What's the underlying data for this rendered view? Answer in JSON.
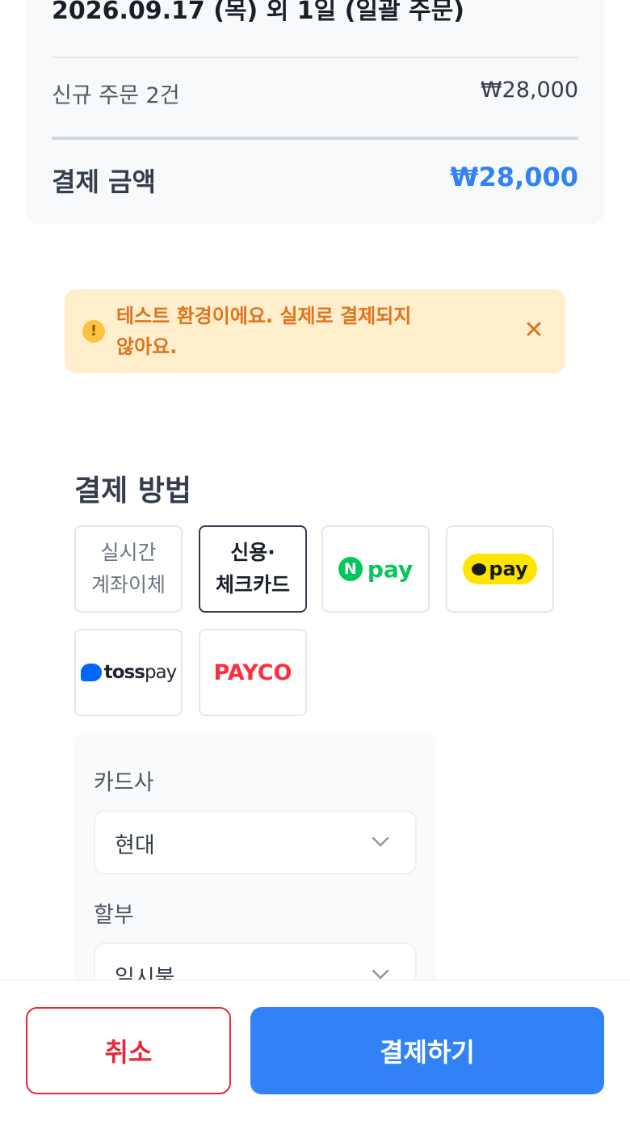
{
  "summary": {
    "order_title": "2026.09.17 (목) 외 1일 (일괄 주문)",
    "new_orders_label": "신규 주문 2건",
    "new_orders_amount": "₩28,000",
    "total_label": "결제 금액",
    "total_amount": "₩28,000"
  },
  "notice": {
    "line1": "테스트 환경이에요. 실제로 결제되지",
    "line2": "않아요.",
    "icon": "exclamation-icon",
    "close_symbol": "✕",
    "warn_symbol": "!"
  },
  "payment": {
    "section_title": "결제 방법",
    "methods": [
      {
        "line1": "실시간",
        "line2": "계좌이체"
      },
      {
        "line1": "신용·",
        "line2": "체크카드",
        "selected": true
      },
      {
        "brand_mark": "N",
        "brand_text": "pay"
      },
      {
        "brand_text": "pay"
      },
      {
        "brand_text_bold": "toss",
        "brand_text": "pay"
      },
      {
        "brand_text": "PAYCO"
      }
    ],
    "card_company_label": "카드사",
    "card_company_value": "현대",
    "installment_label": "할부",
    "installment_value": "일시불"
  },
  "actions": {
    "cancel_label": "취소",
    "pay_label": "결제하기"
  },
  "colors": {
    "accent": "#3182f6",
    "danger": "#e42939",
    "warning_bg": "#ffefcc",
    "warning_text": "#e0731d",
    "naver_green": "#03c75a",
    "kakao_yellow": "#fee500",
    "toss_blue": "#0064ff",
    "payco_red": "#ff2d3f"
  }
}
